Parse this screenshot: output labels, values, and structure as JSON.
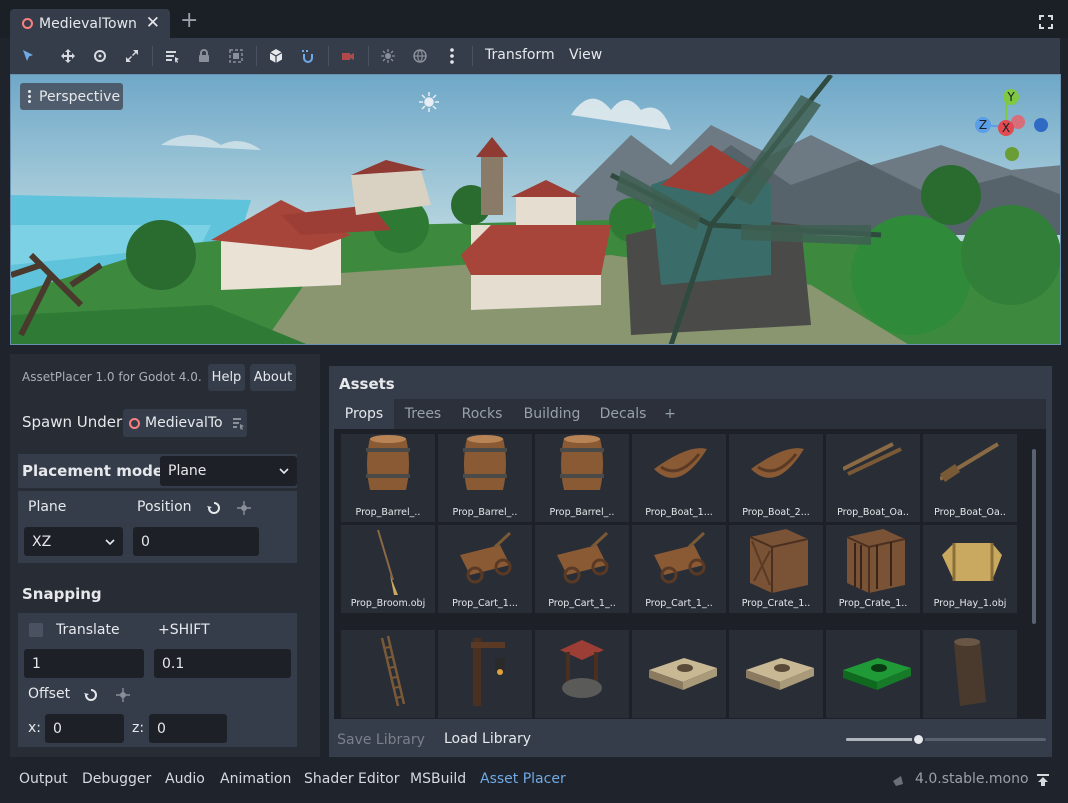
{
  "scene_tab": {
    "label": "MedievalTown",
    "close": "✕"
  },
  "add_tab": "+",
  "toolbar": {
    "transform_menu": "Transform",
    "view_menu": "View"
  },
  "viewport": {
    "perspective_label": "Perspective",
    "gizmo": {
      "y": "Y",
      "z": "Z",
      "x": "X"
    }
  },
  "plugin": {
    "title": "AssetPlacer 1.0 for Godot 4.0.",
    "help_button": "Help",
    "about_button": "About",
    "spawn_under_label": "Spawn Under:",
    "spawn_under_value": "MedievalTo",
    "placement_mode_label": "Placement mode:",
    "placement_mode_value": "Plane",
    "plane_label": "Plane",
    "position_label": "Position",
    "plane_value": "XZ",
    "position_value": "0",
    "snapping_label": "Snapping",
    "translate_label": "Translate",
    "shift_label": "+SHIFT",
    "translate_value": "1",
    "shift_value": "0.1",
    "offset_label": "Offset",
    "x_label": "x:",
    "x_value": "0",
    "z_label": "z:",
    "z_value": "0"
  },
  "assets": {
    "title": "Assets",
    "tabs": [
      "Props",
      "Trees",
      "Rocks",
      "Building",
      "Decals",
      "+"
    ],
    "active_tab": "Props",
    "items": [
      "Prop_Barrel_..",
      "Prop_Barrel_..",
      "Prop_Barrel_..",
      "Prop_Boat_1...",
      "Prop_Boat_2...",
      "Prop_Boat_Oa..",
      "Prop_Boat_Oa..",
      "Prop_Broom.obj",
      "Prop_Cart_1...",
      "Prop_Cart_1_..",
      "Prop_Cart_1_..",
      "Prop_Crate_1..",
      "Prop_Crate_1..",
      "Prop_Hay_1.obj",
      "",
      "",
      "",
      "",
      "",
      "",
      ""
    ],
    "save_library": "Save Library",
    "load_library": "Load Library",
    "zoom": 0.36
  },
  "bottom_panels": [
    "Output",
    "Debugger",
    "Audio",
    "Animation",
    "Shader Editor",
    "MSBuild",
    "Asset Placer"
  ],
  "active_bottom_panel": "Asset Placer",
  "version": "4.0.stable.mono",
  "colors": {
    "accent": "#6fa9e6",
    "scene_ring": "#fc7f7f"
  }
}
